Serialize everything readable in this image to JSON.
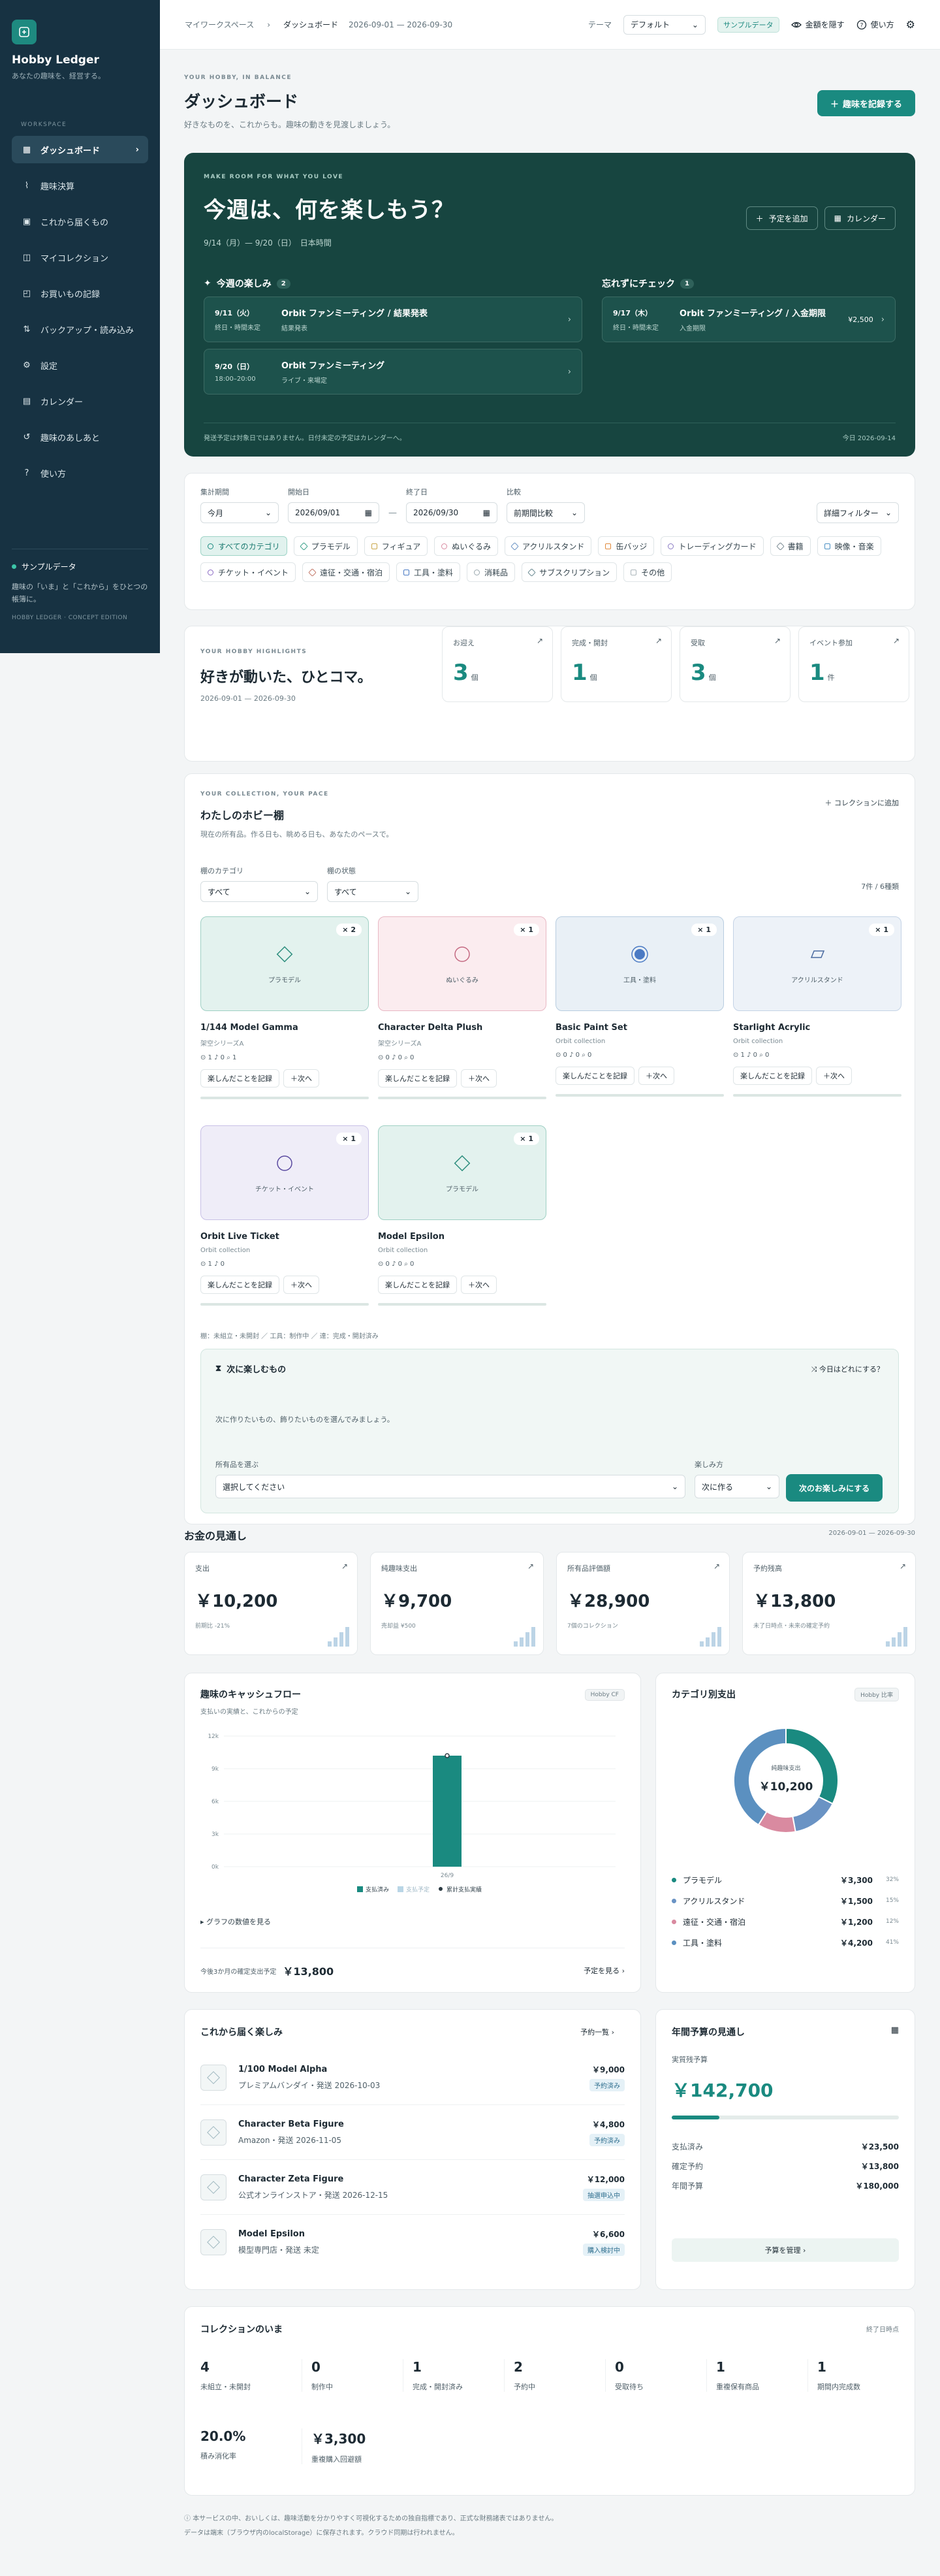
{
  "sidebar": {
    "brand": "Hobby Ledger",
    "tagline": "あなたの趣味を、経営する。",
    "section_label": "WORKSPACE",
    "items": [
      {
        "label": "ダッシュボード",
        "icon": "grid-icon"
      },
      {
        "label": "趣味決算",
        "icon": "chart-icon"
      },
      {
        "label": "これから届くもの",
        "icon": "box-icon"
      },
      {
        "label": "マイコレクション",
        "icon": "collection-icon"
      },
      {
        "label": "お買いもの記録",
        "icon": "cart-icon"
      },
      {
        "label": "バックアップ・読み込み",
        "icon": "transfer-icon"
      },
      {
        "label": "設定",
        "icon": "gear-icon"
      },
      {
        "label": "カレンダー",
        "icon": "calendar-icon"
      },
      {
        "label": "趣味のあしあと",
        "icon": "history-icon"
      },
      {
        "label": "使い方",
        "icon": "help-icon"
      }
    ],
    "sample": {
      "title": "サンプルデータ",
      "desc": "趣味の「いま」と「これから」をひとつの帳簿に。",
      "edition": "HOBBY LEDGER · CONCEPT EDITION"
    }
  },
  "topbar": {
    "crumb_root": "マイワークスペース",
    "crumb_current": "ダッシュボード",
    "range": "2026-09-01 — 2026-09-30",
    "theme_label": "テーマ",
    "theme_value": "デフォルト",
    "sample_badge": "サンプルデータ",
    "hide_amounts": "金額を隠す",
    "help": "使い方"
  },
  "header": {
    "eyebrow": "YOUR HOBBY, IN BALANCE",
    "title": "ダッシュボード",
    "subtitle": "好きなものを、これからも。趣味の動きを見渡しましょう。",
    "record_button": "趣味を記録する"
  },
  "hero": {
    "eyebrow": "MAKE ROOM FOR WHAT YOU LOVE",
    "title": "今週は、何を楽しもう？",
    "date_range": "9/14（月）— 9/20（日）",
    "tz": "日本時間",
    "add_plan": "予定を追加",
    "calendar": "カレンダー",
    "week_title": "今週の楽しみ",
    "week_count": "2",
    "week_events": [
      {
        "date": "9/11（火）",
        "time": "終日・時間未定",
        "title": "Orbit ファンミーティング / 結果発表",
        "sub": "結果発表"
      },
      {
        "date": "9/20（日）",
        "time": "18:00–20:00",
        "title": "Orbit ファンミーティング",
        "sub": "ライブ・来場定"
      }
    ],
    "check_title": "忘れずにチェック",
    "check_count": "1",
    "check_events": [
      {
        "date": "9/17（木）",
        "time": "終日・時間未定",
        "title": "Orbit ファンミーティング / 入金期限",
        "sub": "入金期限",
        "amount": "¥2,500"
      }
    ],
    "foot_left": "発送予定は対象日ではありません。日付未定の予定はカレンダーへ。",
    "foot_right": "今日 2026-09-14"
  },
  "filters": {
    "period_label": "集計期間",
    "period_value": "今月",
    "start_label": "開始日",
    "start_value": "2026/09/01",
    "sep": "—",
    "end_label": "終了日",
    "end_value": "2026/09/30",
    "compare_label": "比較",
    "compare_value": "前期間比較",
    "detail_button": "詳細フィルター",
    "chips": [
      {
        "label": "すべてのカテゴリ",
        "color": "#1a8a80",
        "active": true
      },
      {
        "label": "プラモデル",
        "color": "#3aa08a"
      },
      {
        "label": "フィギュア",
        "color": "#c9a64a"
      },
      {
        "label": "ぬいぐるみ",
        "color": "#d98aa0"
      },
      {
        "label": "アクリルスタンド",
        "color": "#6a93c4"
      },
      {
        "label": "缶バッジ",
        "color": "#e08a3c"
      },
      {
        "label": "トレーディングカード",
        "color": "#8a7ac4"
      },
      {
        "label": "書籍",
        "color": "#7a8a92"
      },
      {
        "label": "映像・音楽",
        "color": "#4a90c4"
      },
      {
        "label": "チケット・イベント",
        "color": "#8a6ac4"
      },
      {
        "label": "遠征・交通・宿泊",
        "color": "#c47a6a"
      },
      {
        "label": "工具・塗料",
        "color": "#4a7ac4"
      },
      {
        "label": "消耗品",
        "color": "#9aa8ae"
      },
      {
        "label": "サブスクリプション",
        "color": "#6a8a92"
      },
      {
        "label": "その他",
        "color": "#aab5ba"
      }
    ]
  },
  "highlights": {
    "eyebrow": "YOUR HOBBY HIGHLIGHTS",
    "title": "好きが動いた、ひとコマ。",
    "range": "2026-09-01 — 2026-09-30",
    "stats": [
      {
        "label": "お迎え",
        "value": "3",
        "unit": "個"
      },
      {
        "label": "完成・開封",
        "value": "1",
        "unit": "個"
      },
      {
        "label": "受取",
        "value": "3",
        "unit": "個"
      },
      {
        "label": "イベント参加",
        "value": "1",
        "unit": "件"
      }
    ]
  },
  "collection": {
    "eyebrow": "YOUR COLLECTION, YOUR PACE",
    "title": "わたしのホビー棚",
    "subtitle": "現在の所有品。作る日も、眺める日も、あなたのペースで。",
    "add_link": "コレクションに追加",
    "cat_label": "棚のカテゴリ",
    "cat_value": "すべて",
    "state_label": "棚の状態",
    "state_value": "すべて",
    "count_text": "7件 / 6種類",
    "items": [
      {
        "name": "1/144 Model Gamma",
        "sub": "架空シリーズA",
        "cat": "プラモデル",
        "qty": "× 2",
        "meta": "⊙ 1  ♪ 0  ⌕ 1",
        "bg": "#e3f2ee",
        "border": "#9fd0c4",
        "shape": "diamond"
      },
      {
        "name": "Character Delta Plush",
        "sub": "架空シリーズA",
        "cat": "ぬいぐるみ",
        "qty": "× 1",
        "meta": "⊙ 0  ♪ 0  ⌕ 0",
        "bg": "#fbecef",
        "border": "#e8b8c4",
        "shape": "circle"
      },
      {
        "name": "Basic Paint Set",
        "sub": "Orbit collection",
        "cat": "工具・塗料",
        "qty": "× 1",
        "meta": "⊙ 0  ♪ 0  ⌕ 0",
        "bg": "#e9f0f6",
        "border": "#b8cde0",
        "shape": "dot"
      },
      {
        "name": "Starlight Acrylic",
        "sub": "Orbit collection",
        "cat": "アクリルスタンド",
        "qty": "× 1",
        "meta": "⊙ 1  ♪ 0  ⌕ 0",
        "bg": "#edf2f8",
        "border": "#c4d3e6",
        "shape": "para"
      },
      {
        "name": "Orbit Live Ticket",
        "sub": "Orbit collection",
        "cat": "チケット・イベント",
        "qty": "× 1",
        "meta": "⊙ 1  ♪ 0",
        "bg": "#efedf8",
        "border": "#c8c0e6",
        "shape": "circle"
      },
      {
        "name": "Model Epsilon",
        "sub": "Orbit collection",
        "cat": "プラモデル",
        "qty": "× 1",
        "meta": "⊙ 0  ♪ 0  ⌕ 0",
        "bg": "#e3f2ee",
        "border": "#9fd0c4",
        "shape": "diamond"
      }
    ],
    "btn_record": "楽しんだことを記録",
    "btn_next": "次へ",
    "legend_note": "棚：未組立・未開封 ／ 工具：制作中 ／ 達：完成・開封済み",
    "next": {
      "title": "次に楽しむもの",
      "random": "今日はどれにする？",
      "desc": "次に作りたいもの、飾りたいものを選んでみましょう。",
      "select_label": "所有品を選ぶ",
      "select_value": "選択してください",
      "how_label": "楽しみ方",
      "how_value": "次に作る",
      "submit": "次のお楽しみにする"
    }
  },
  "money": {
    "title": "お金の見通し",
    "range": "2026-09-01 — 2026-09-30",
    "cards": [
      {
        "label": "支出",
        "value": "￥10,200",
        "sub": "前期比 -21%"
      },
      {
        "label": "純趣味支出",
        "value": "￥9,700",
        "sub": "売却益 ¥500"
      },
      {
        "label": "所有品評価額",
        "value": "￥28,900",
        "sub": "7個のコレクション"
      },
      {
        "label": "予約残高",
        "value": "￥13,800",
        "sub": "未了日時点・未来の確定予約"
      }
    ]
  },
  "cashflow": {
    "title": "趣味のキャッシュフロー",
    "subtitle": "支払いの実績と、これからの予定",
    "badge": "Hobby CF",
    "expand": "グラフの数値を見る",
    "foot_label": "今後3か月の確定支出予定",
    "foot_value": "￥13,800",
    "foot_link": "予定を見る"
  },
  "chart_data": [
    {
      "type": "bar",
      "categories": [
        "26/9"
      ],
      "series": [
        {
          "name": "支払済み",
          "values": [
            10200
          ],
          "color": "#1a8a80"
        },
        {
          "name": "支払予定",
          "values": [
            0
          ],
          "color": "#b9d6e6"
        },
        {
          "name": "累計支払実績",
          "values": [
            10200
          ],
          "color": "#2b3a42"
        }
      ],
      "yticks": [
        "12k",
        "9k",
        "6k",
        "3k",
        "0k"
      ],
      "ylim": [
        0,
        12000
      ]
    },
    {
      "type": "pie",
      "title": "カテゴリ別支出",
      "badge": "Hobby 比率",
      "center_label": "純趣味支出",
      "center_value": "￥10,200",
      "slices": [
        {
          "label": "プラモデル",
          "value": 3300,
          "pct": "32%",
          "display": "￥3,300",
          "color": "#1a8a80"
        },
        {
          "label": "アクリルスタンド",
          "value": 1500,
          "pct": "15%",
          "display": "￥1,500",
          "color": "#6a93c4"
        },
        {
          "label": "遠征・交通・宿泊",
          "value": 1200,
          "pct": "12%",
          "display": "￥1,200",
          "color": "#d98aa0"
        },
        {
          "label": "工具・塗料",
          "value": 4200,
          "pct": "41%",
          "display": "￥4,200",
          "color": "#5b90c0"
        }
      ]
    }
  ],
  "upcoming": {
    "title": "これから届く楽しみ",
    "link": "予約一覧",
    "items": [
      {
        "name": "1/100 Model Alpha",
        "sub": "プレミアムバンダイ・発送 2026-10-03",
        "price": "￥9,000",
        "status": "予約済み"
      },
      {
        "name": "Character Beta Figure",
        "sub": "Amazon・発送 2026-11-05",
        "price": "￥4,800",
        "status": "予約済み"
      },
      {
        "name": "Character Zeta Figure",
        "sub": "公式オンラインストア・発送 2026-12-15",
        "price": "￥12,000",
        "status": "抽選申込中"
      },
      {
        "name": "Model Epsilon",
        "sub": "模型専門店・発送 未定",
        "price": "￥6,600",
        "status": "購入検討中"
      }
    ]
  },
  "budget": {
    "title": "年間予算の見通し",
    "label": "実質残予算",
    "value": "￥142,700",
    "progress": 0.21,
    "rows": [
      {
        "label": "支払済み",
        "value": "￥23,500"
      },
      {
        "label": "確定予約",
        "value": "￥13,800"
      },
      {
        "label": "年間予算",
        "value": "￥180,000"
      }
    ],
    "manage": "予算を管理"
  },
  "collection_now": {
    "title": "コレクションのいま",
    "date": "終了日時点",
    "stats": [
      {
        "value": "4",
        "label": "未組立・未開封"
      },
      {
        "value": "0",
        "label": "制作中"
      },
      {
        "value": "1",
        "label": "完成・開封済み"
      },
      {
        "value": "2",
        "label": "予約中"
      },
      {
        "value": "0",
        "label": "受取待ち"
      },
      {
        "value": "1",
        "label": "重複保有商品"
      },
      {
        "value": "1",
        "label": "期間内完成数"
      },
      {
        "value": "20.0%",
        "label": "積み消化率"
      },
      {
        "value": "￥3,300",
        "label": "重複購入回避額"
      }
    ]
  },
  "footer": {
    "line1": "本サービスの中、おいしくは、趣味活動を分かりやすく可視化するための独自指標であり、正式な財務諸表ではありません。",
    "line2": "データは端末（ブラウザ内のlocalStorage）に保存されます。クラウド同期は行われません。"
  }
}
